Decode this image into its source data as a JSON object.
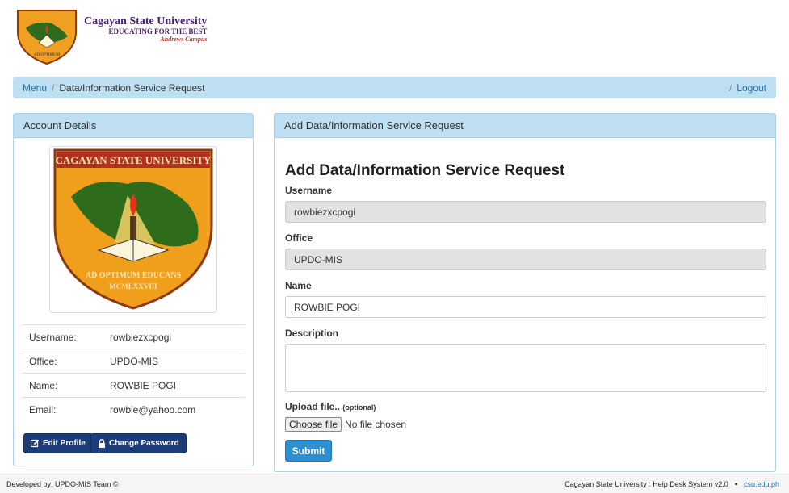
{
  "header": {
    "title": "Cagayan State University",
    "motto": "EDUCATING FOR THE BEST",
    "campus": "Andrews Campus"
  },
  "breadcrumb": {
    "menu": "Menu",
    "sep": "/",
    "current": "Data/Information Service Request",
    "logout": "Logout"
  },
  "account": {
    "heading": "Account Details",
    "seal_title": "CAGAYAN STATE UNIVERSITY",
    "seal_motto": "AD OPTIMUM EDUCANS",
    "seal_year": "MCMLXXVIII",
    "rows": [
      {
        "label": "Username:",
        "value": "rowbiezxcpogi"
      },
      {
        "label": "Office:",
        "value": "UPDO-MIS"
      },
      {
        "label": "Name:",
        "value": "ROWBIE POGI"
      },
      {
        "label": "Email:",
        "value": "rowbie@yahoo.com"
      }
    ],
    "edit_label": "Edit Profile",
    "password_label": "Change Password"
  },
  "form": {
    "heading": "Add Data/Information Service Request",
    "title": "Add Data/Information Service Request",
    "username_label": "Username",
    "username_value": "rowbiezxcpogi",
    "office_label": "Office",
    "office_value": "UPDO-MIS",
    "name_label": "Name",
    "name_value": "ROWBIE POGI",
    "description_label": "Description",
    "upload_label": "Upload file..",
    "upload_optional": "(optional)",
    "choose_file": "Choose file",
    "no_file": "No file chosen",
    "submit": "Submit"
  },
  "footer": {
    "left": "Developed by: UPDO-MIS Team ©",
    "system": "Cagayan State University : Help Desk System v2.0",
    "bullet": "•",
    "site": "csu.edu.ph"
  },
  "colors": {
    "accent": "#bfe0f2",
    "primary_button": "#1b3d7a",
    "submit_button": "#2d8fd0",
    "link": "#1d6fa5"
  }
}
